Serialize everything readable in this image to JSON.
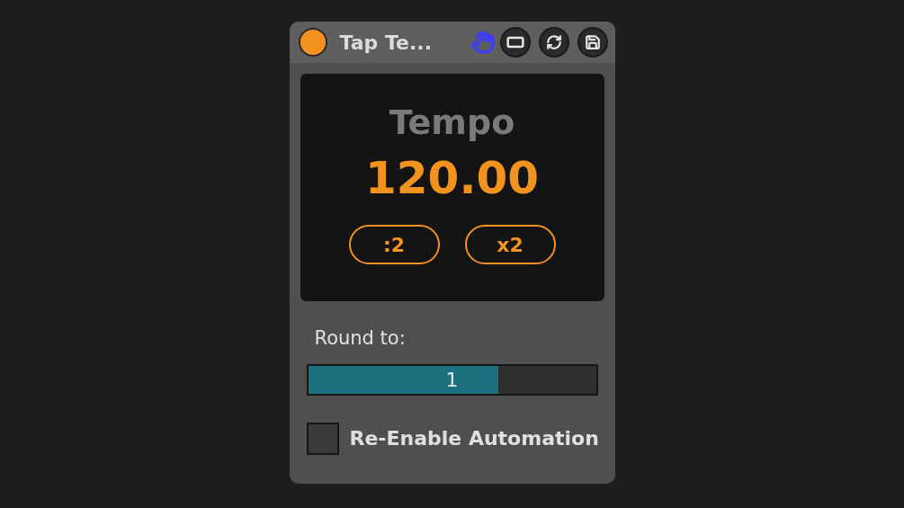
{
  "device": {
    "title": "Tap Te...",
    "on": true
  },
  "display": {
    "label": "Tempo",
    "value": "120.00",
    "buttons": [
      ":2",
      "x2"
    ]
  },
  "round": {
    "label": "Round to:",
    "value": "1",
    "level": 0.66
  },
  "automation": {
    "label": "Re-Enable Automation",
    "checked": false
  }
}
